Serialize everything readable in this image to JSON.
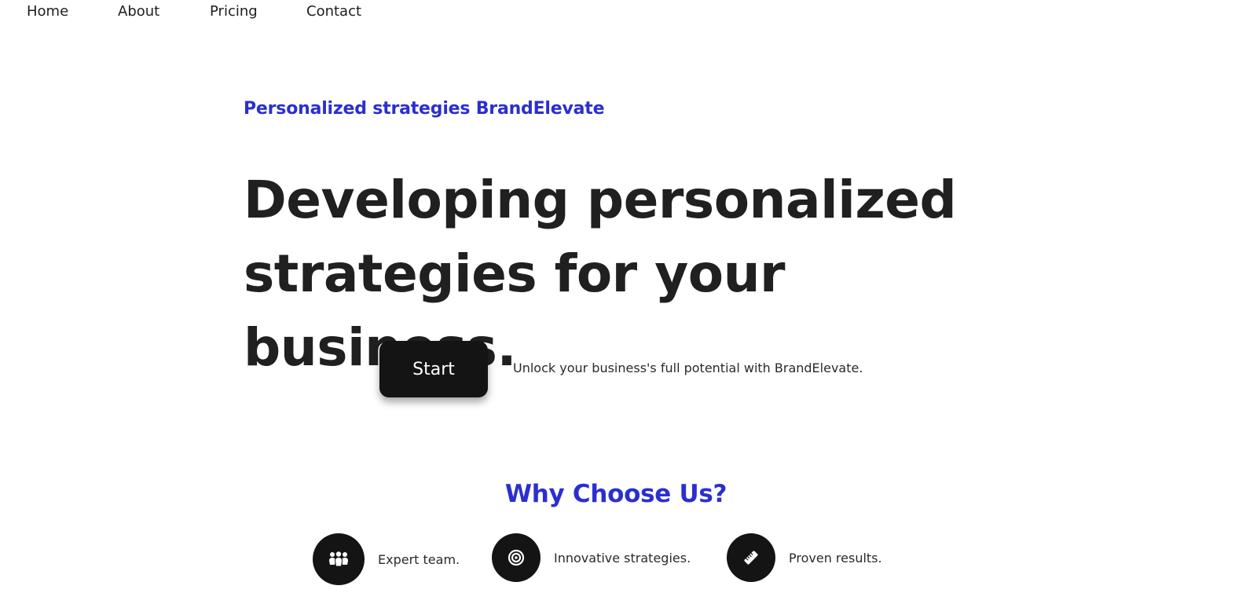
{
  "nav": {
    "items": [
      {
        "label": "Home"
      },
      {
        "label": "About"
      },
      {
        "label": "Pricing"
      },
      {
        "label": "Contact"
      }
    ]
  },
  "hero": {
    "eyebrow": "Personalized strategies BrandElevate",
    "headline_line1": "Developing personalized",
    "headline_line2": "strategies for your business.",
    "start_label": "Start",
    "tagline": "Unlock your business's full potential with BrandElevate."
  },
  "why": {
    "title": "Why Choose Us?",
    "features": [
      {
        "label": "Expert team.",
        "icon": "team-icon"
      },
      {
        "label": "Innovative strategies.",
        "icon": "target-icon"
      },
      {
        "label": "Proven results.",
        "icon": "ruler-icon"
      }
    ]
  },
  "colors": {
    "accent": "#2b2fd0",
    "dark": "#141414",
    "text": "#202020"
  }
}
